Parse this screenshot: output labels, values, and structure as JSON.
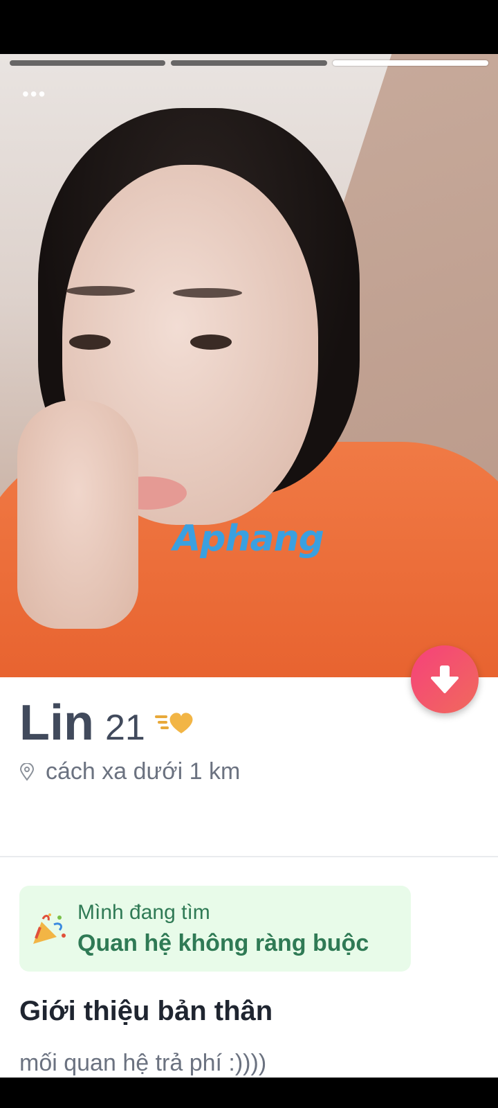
{
  "photo": {
    "progress": {
      "total": 3,
      "active_index": 2
    },
    "more_label": "•••",
    "watermark": "Aphang"
  },
  "profile": {
    "name": "Lin",
    "age": "21",
    "distance": "cách xa dưới 1 km"
  },
  "looking_for": {
    "label": "Mình đang tìm",
    "value": "Quan hệ không ràng buộc"
  },
  "about": {
    "title": "Giới thiệu bản thân",
    "text": "mối quan hệ trả phí :))))"
  },
  "colors": {
    "accent_gradient_start": "#f6417b",
    "accent_gradient_end": "#f06a5c",
    "looking_bg": "#e8fbe9",
    "looking_text": "#2f7a55",
    "name_text": "#414a5c"
  },
  "icons": [
    "more-icon",
    "arrow-down-icon",
    "boost-heart-icon",
    "location-pin-icon",
    "party-icon"
  ]
}
